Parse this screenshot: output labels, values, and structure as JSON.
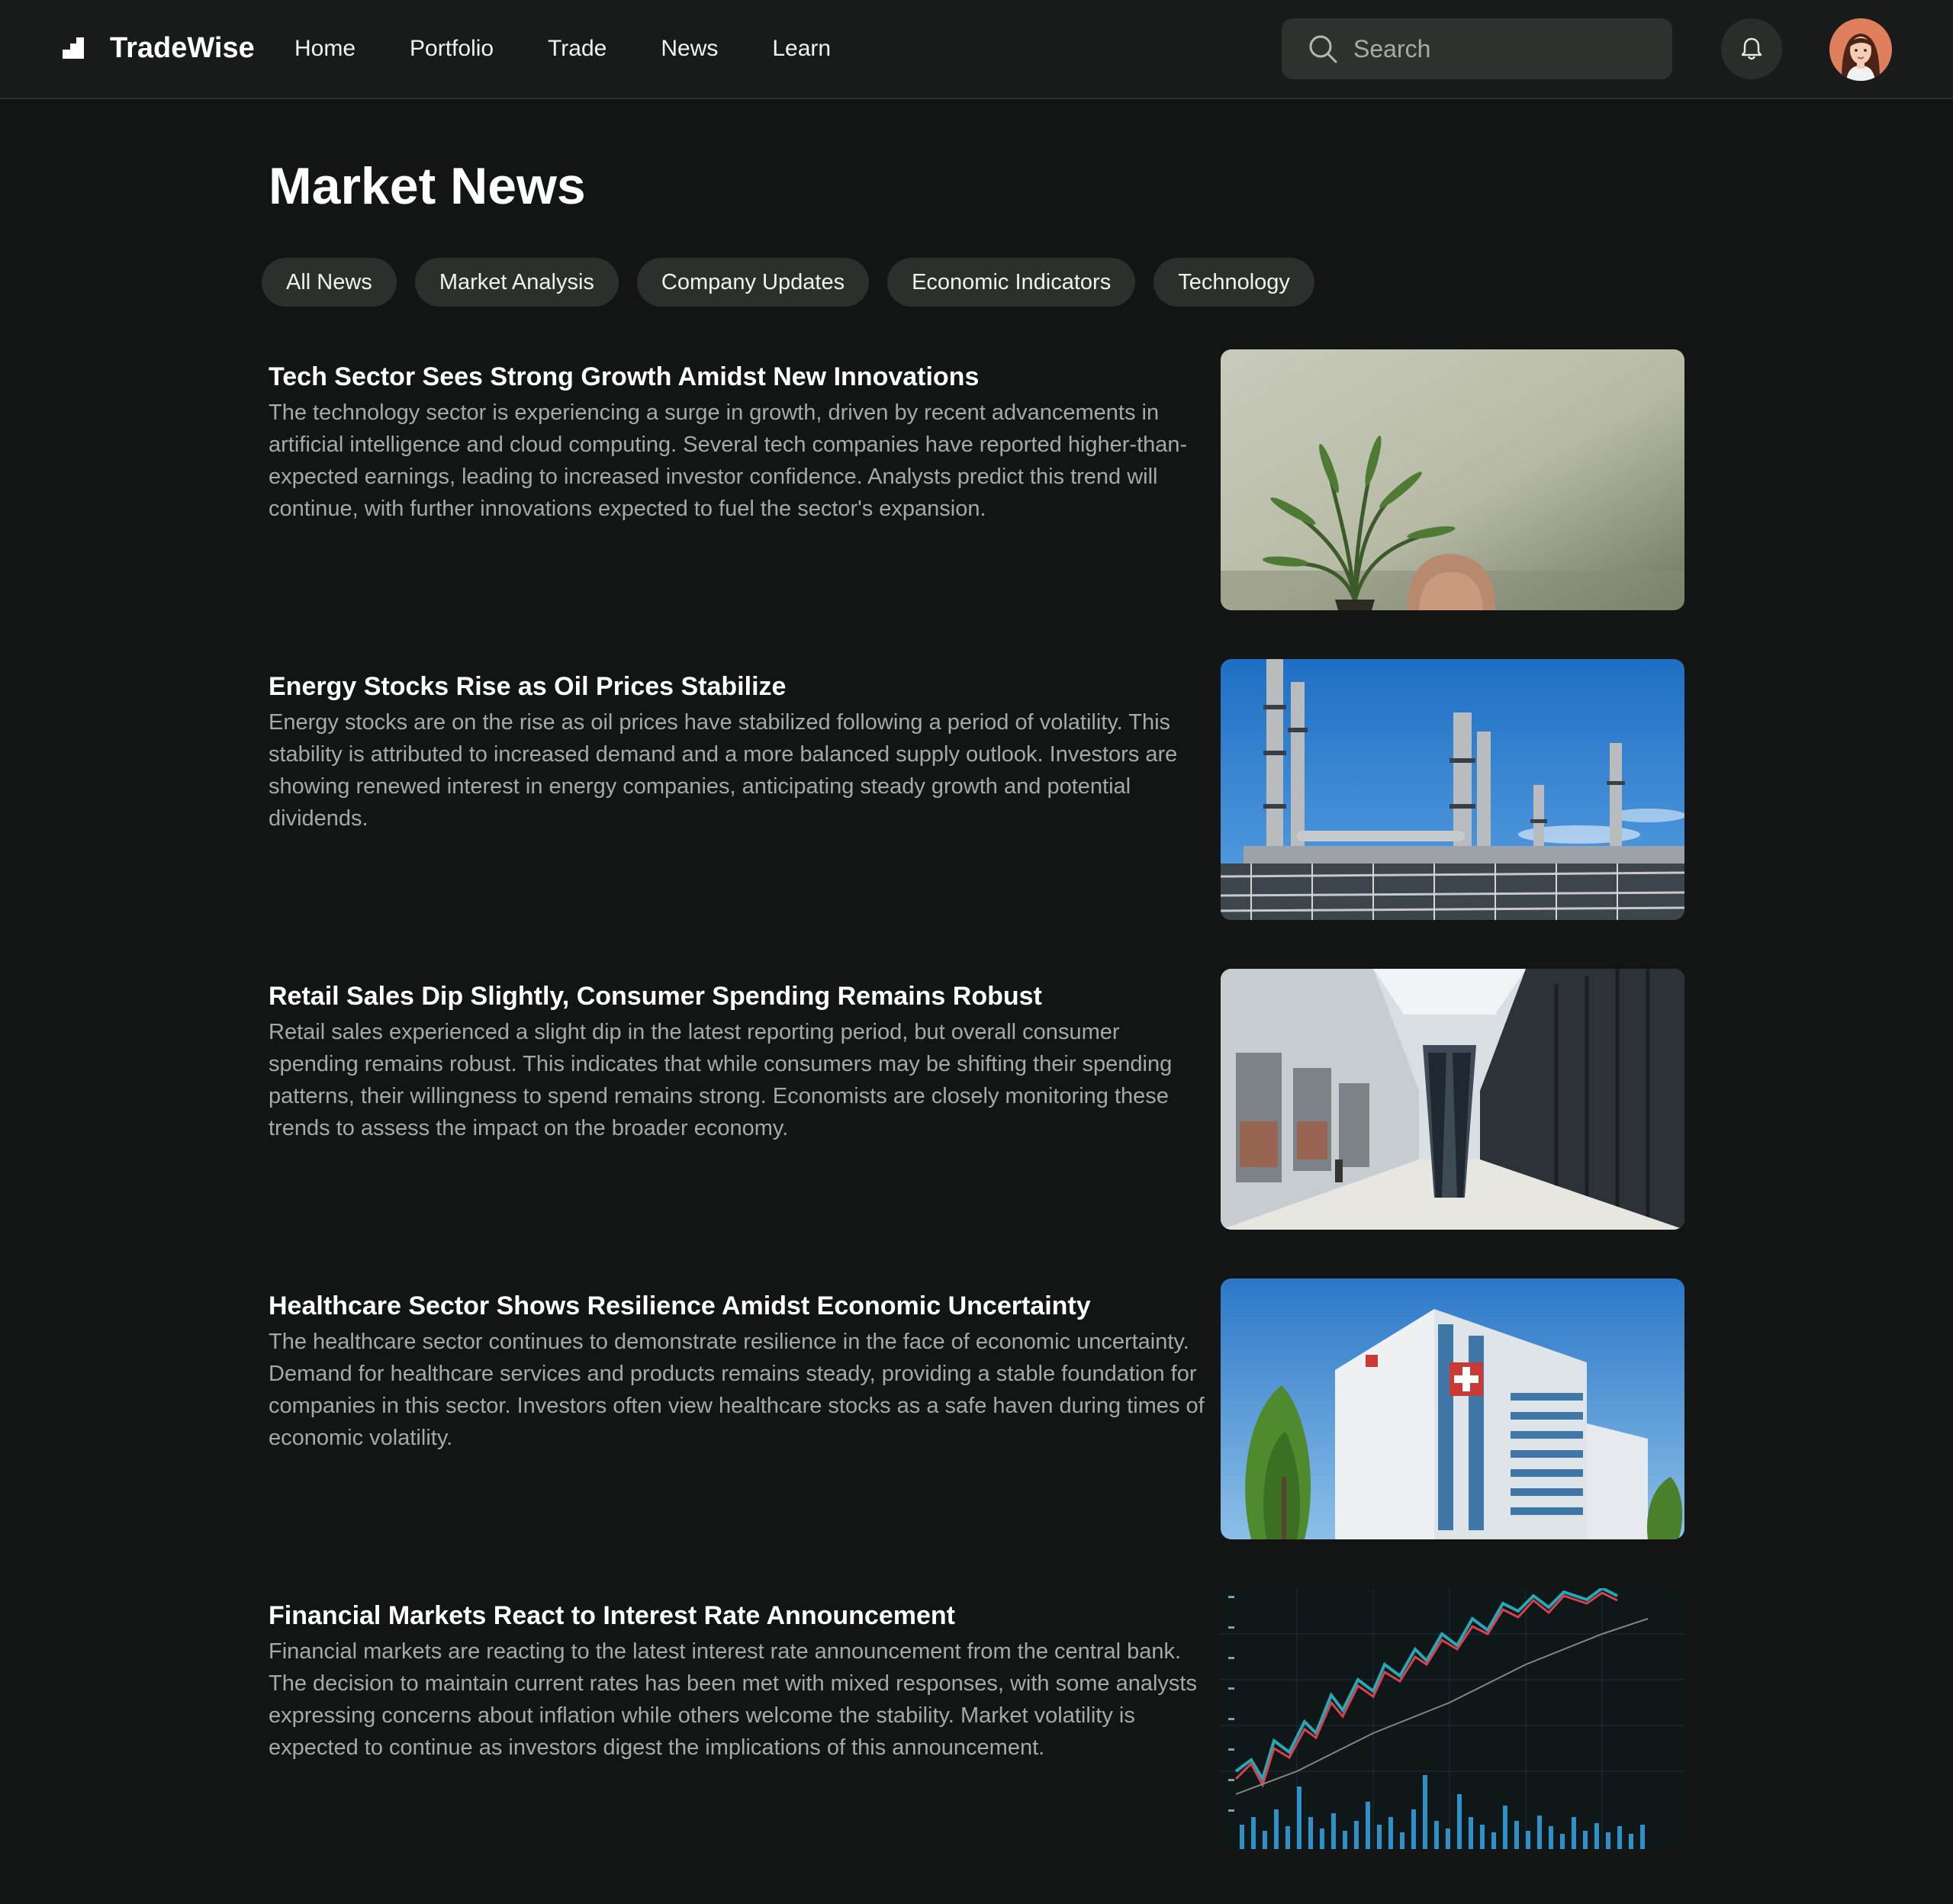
{
  "brand": {
    "name": "TradeWise"
  },
  "nav": {
    "home": "Home",
    "portfolio": "Portfolio",
    "trade": "Trade",
    "news": "News",
    "learn": "Learn"
  },
  "search": {
    "placeholder": "Search"
  },
  "page": {
    "title": "Market News"
  },
  "filters": [
    "All News",
    "Market Analysis",
    "Company Updates",
    "Economic Indicators",
    "Technology"
  ],
  "articles": [
    {
      "title": "Tech Sector Sees Strong Growth Amidst New Innovations",
      "summary": "The technology sector is experiencing a surge in growth, driven by recent advancements in artificial intelligence and cloud computing. Several tech companies have reported higher-than-expected earnings, leading to increased investor confidence. Analysts predict this trend will continue, with further innovations expected to fuel the sector's expansion.",
      "image": "plant-and-chair-photo"
    },
    {
      "title": "Energy Stocks Rise as Oil Prices Stabilize",
      "summary": "Energy stocks are on the rise as oil prices have stabilized following a period of volatility. This stability is attributed to increased demand and a more balanced supply outlook. Investors are showing renewed interest in energy companies, anticipating steady growth and potential dividends.",
      "image": "refinery-photo"
    },
    {
      "title": "Retail Sales Dip Slightly, Consumer Spending Remains Robust",
      "summary": "Retail sales experienced a slight dip in the latest reporting period, but overall consumer spending remains robust. This indicates that while consumers may be shifting their spending patterns, their willingness to spend remains strong. Economists are closely monitoring these trends to assess the impact on the broader economy.",
      "image": "shopping-mall-photo"
    },
    {
      "title": "Healthcare Sector Shows Resilience Amidst Economic Uncertainty",
      "summary": "The healthcare sector continues to demonstrate resilience in the face of economic uncertainty. Demand for healthcare services and products remains steady, providing a stable foundation for companies in this sector. Investors often view healthcare stocks as a safe haven during times of economic volatility.",
      "image": "hospital-building-photo"
    },
    {
      "title": "Financial Markets React to Interest Rate Announcement",
      "summary": "Financial markets are reacting to the latest interest rate announcement from the central bank. The decision to maintain current rates has been met with mixed responses, with some analysts expressing concerns about inflation while others welcome the stability. Market volatility is expected to continue as investors digest the implications of this announcement.",
      "image": "stock-chart-photo"
    }
  ],
  "colors": {
    "background": "#121513",
    "header": "#191b1a",
    "chip": "#2b302c",
    "body_text": "#a6aaa7"
  }
}
